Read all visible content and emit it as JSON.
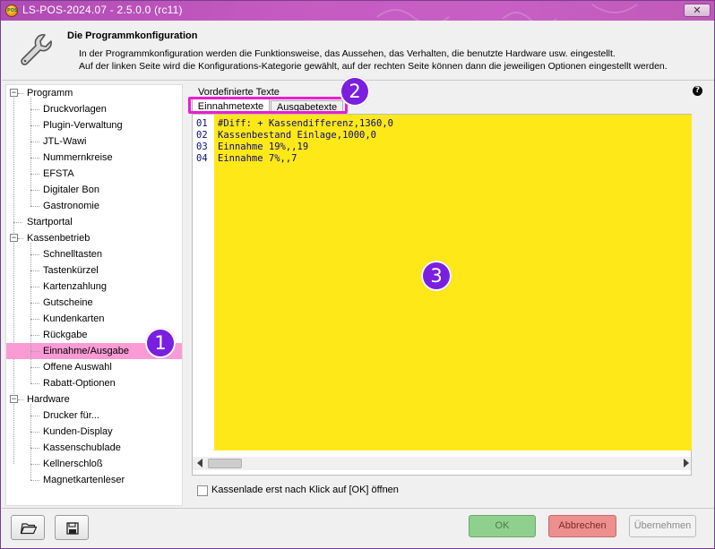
{
  "window": {
    "title": "LS-POS-2024.07 - 2.5.0.0 (rc11)",
    "close_glyph": "✕",
    "accent": "#c55bc2"
  },
  "header": {
    "icon": "wrench-icon",
    "title": "Die Programmkonfiguration",
    "desc_line1": "In der Programmkonfiguration werden die Funktionsweise, das Aussehen, das Verhalten, die benutzte Hardware usw. eingestellt.",
    "desc_line2": "Auf der linken Seite wird die Konfigurations-Kategorie gewählt, auf der rechten Seite können dann die jeweiligen Optionen eingestellt werden."
  },
  "tree": {
    "groups": [
      {
        "label": "Programm",
        "expander": "−",
        "items": [
          "Druckvorlagen",
          "Plugin-Verwaltung",
          "JTL-Wawi",
          "Nummernkreise",
          "EFSTA",
          "Digitaler Bon",
          "Gastronomie"
        ]
      },
      {
        "label": "Startportal"
      },
      {
        "label": "Kassenbetrieb",
        "expander": "−",
        "items": [
          "Schnelltasten",
          "Tastenkürzel",
          "Kartenzahlung",
          "Gutscheine",
          "Kundenkarten",
          "Rückgabe",
          "Einnahme/Ausgabe",
          "Offene Auswahl",
          "Rabatt-Optionen"
        ]
      },
      {
        "label": "Hardware",
        "expander": "−",
        "items": [
          "Drucker für...",
          "Kunden-Display",
          "Kassenschublade",
          "Kellnerschloß",
          "Magnetkartenleser"
        ]
      }
    ],
    "selected": "Einnahme/Ausgabe",
    "selected_color": "#fa9bd6"
  },
  "panel": {
    "group_label": "Vordefinierte Texte",
    "help_glyph": "?",
    "tabs": [
      {
        "label": "Einnahmetexte",
        "active": true
      },
      {
        "label": "Ausgabetexte",
        "active": false
      }
    ],
    "editor_bg": "#ffe817",
    "lines": [
      {
        "num": "01",
        "text": "#Diff: + Kassendifferenz,1360,0"
      },
      {
        "num": "02",
        "text": "Kassenbestand Einlage,1000,0"
      },
      {
        "num": "03",
        "text": "Einnahme 19%,,19"
      },
      {
        "num": "04",
        "text": "Einnahme 7%,,7"
      }
    ],
    "checkbox_label": "Kassenlade erst nach Klick auf [OK] öffnen",
    "checkbox_checked": false
  },
  "footer": {
    "open_icon": "folder-open-icon",
    "save_icon": "floppy-disk-icon",
    "ok_label": "OK",
    "cancel_label": "Abbrechen",
    "apply_label": "Übernehmen"
  },
  "annotations": {
    "badge1": "1",
    "badge2": "2",
    "badge3": "3",
    "badge_color": "#7a1fe0",
    "highlight_color": "#ea1fd0"
  }
}
